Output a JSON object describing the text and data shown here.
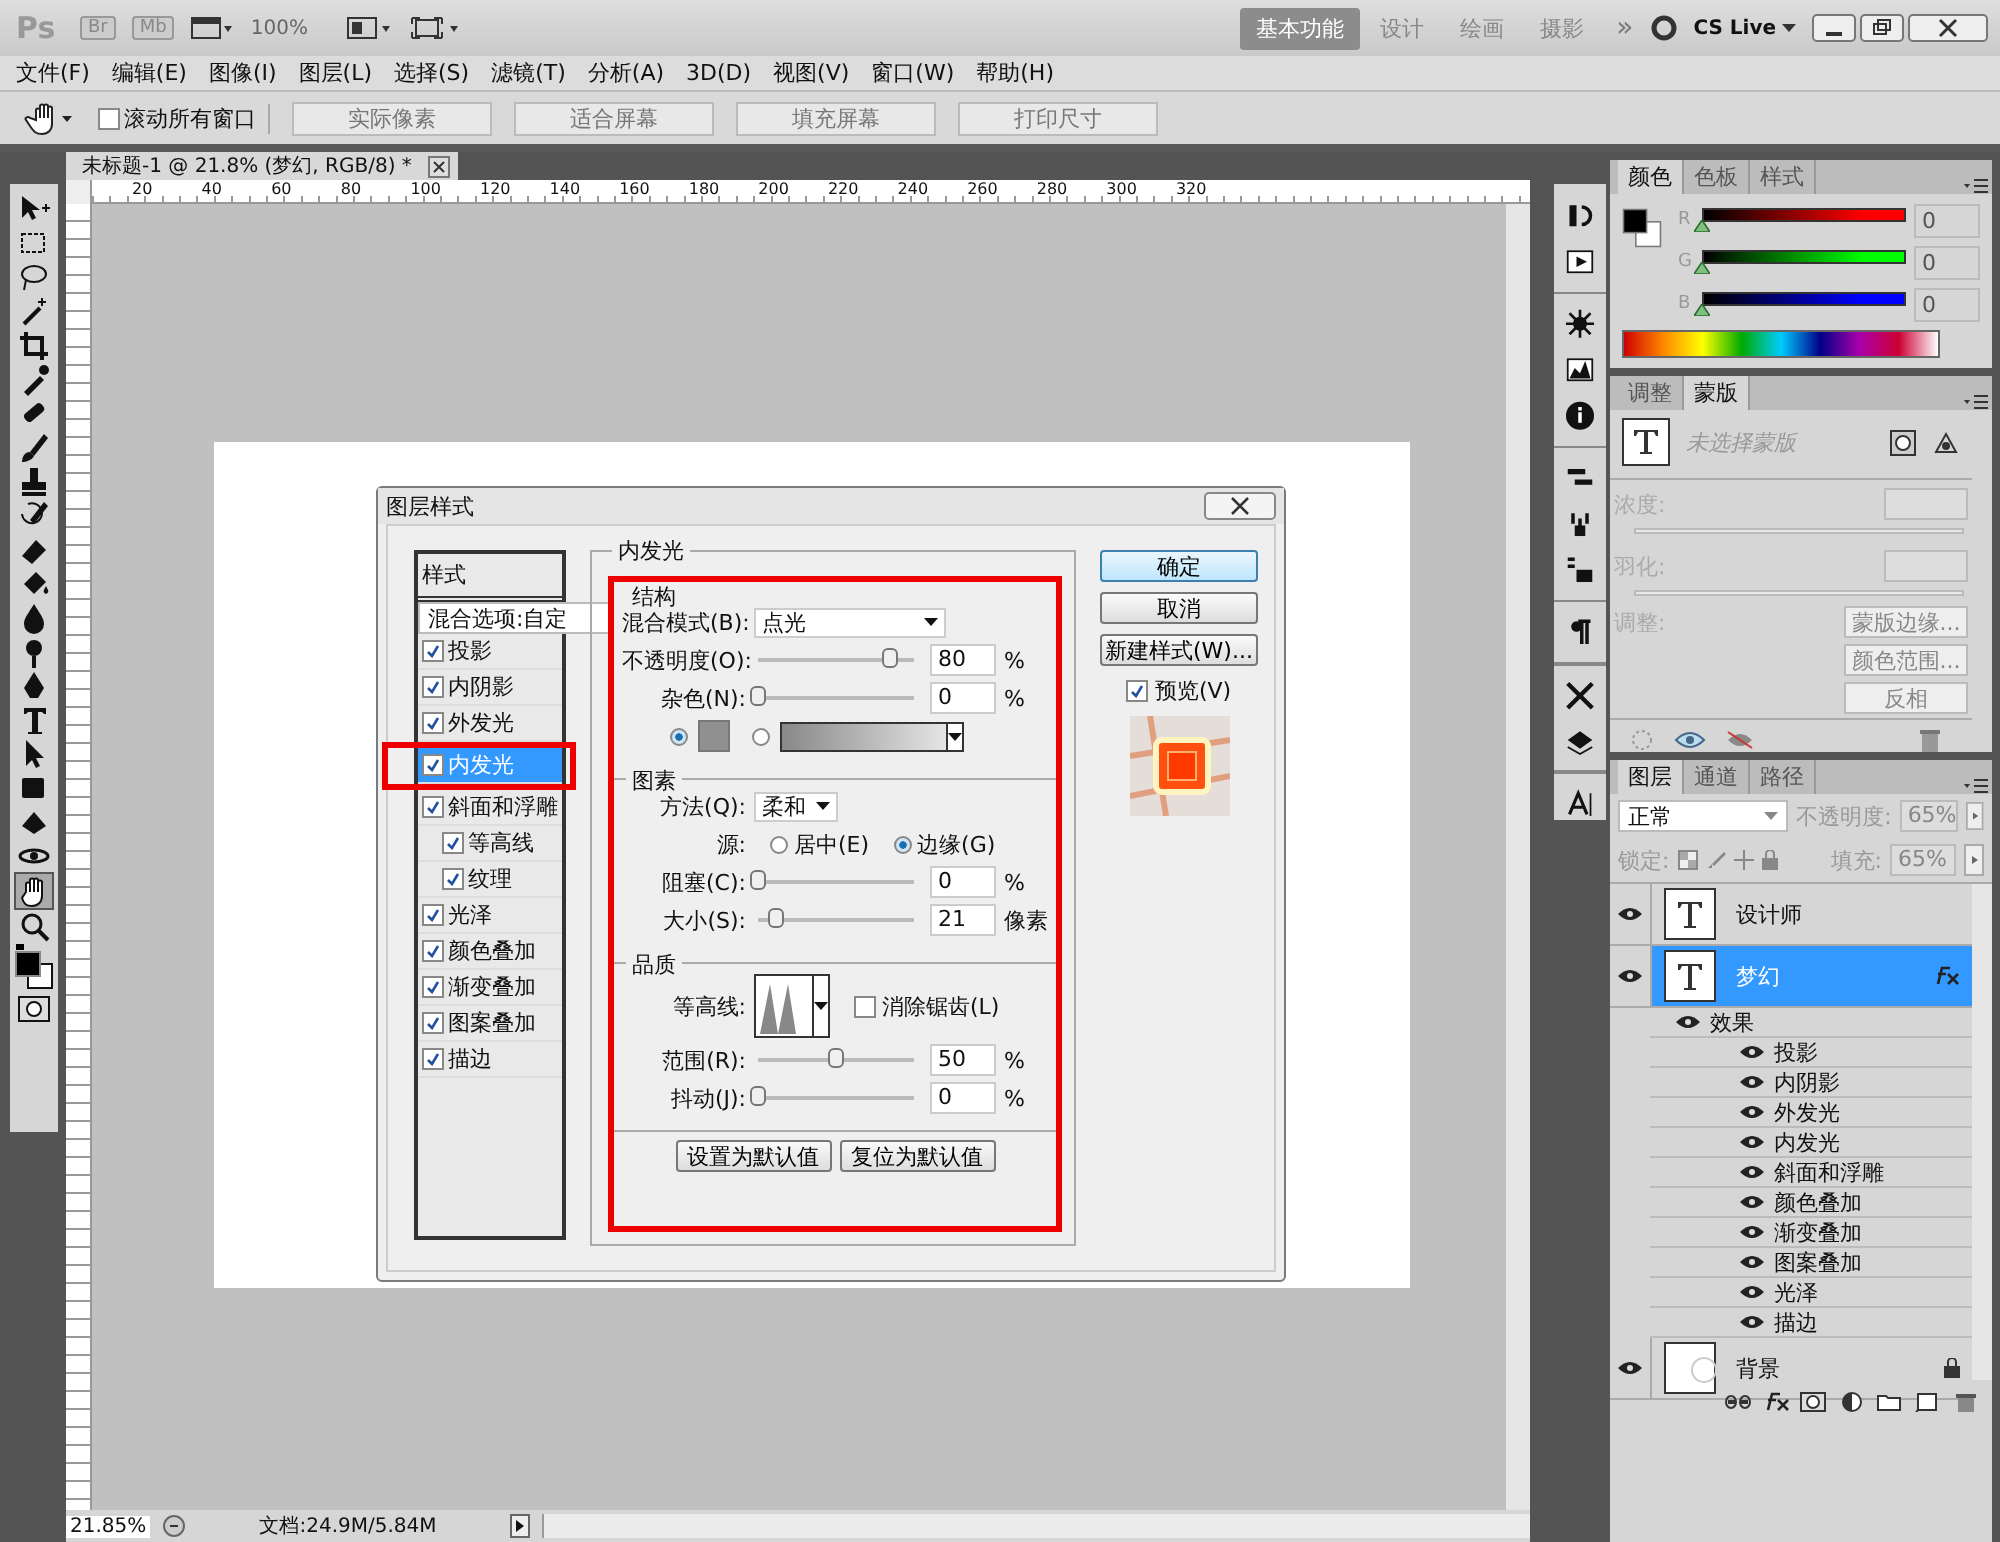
{
  "app_bar": {
    "logo": "Ps",
    "bridge": "Br",
    "mini_bridge": "Mb",
    "zoom": "100%",
    "workspaces": [
      {
        "label": "基本功能",
        "selected": true
      },
      {
        "label": "设计",
        "selected": false
      },
      {
        "label": "绘画",
        "selected": false
      },
      {
        "label": "摄影",
        "selected": false
      }
    ],
    "more": "»",
    "cs_live": "CS Live"
  },
  "menu": [
    "文件(F)",
    "编辑(E)",
    "图像(I)",
    "图层(L)",
    "选择(S)",
    "滤镜(T)",
    "分析(A)",
    "3D(D)",
    "视图(V)",
    "窗口(W)",
    "帮助(H)"
  ],
  "options_bar": {
    "scroll_all": {
      "label": "滚动所有窗口",
      "checked": false
    },
    "buttons": [
      "实际像素",
      "适合屏幕",
      "填充屏幕",
      "打印尺寸"
    ]
  },
  "document": {
    "tab_title": "未标题-1 @ 21.8% (梦幻, RGB/8) *",
    "ruler_marks": [
      "20",
      "40",
      "60",
      "80",
      "100",
      "120",
      "140",
      "160",
      "180",
      "200",
      "220",
      "240",
      "260",
      "280",
      "300",
      "320"
    ]
  },
  "dialog": {
    "title": "图层样式",
    "styles_header": "样式",
    "blend_options": "混合选项:自定",
    "effects": [
      {
        "label": "投影",
        "checked": true,
        "selected": false
      },
      {
        "label": "内阴影",
        "checked": true,
        "selected": false
      },
      {
        "label": "外发光",
        "checked": true,
        "selected": false
      },
      {
        "label": "内发光",
        "checked": true,
        "selected": true
      },
      {
        "label": "斜面和浮雕",
        "checked": true,
        "selected": false,
        "children": [
          {
            "label": "等高线",
            "checked": true,
            "selected": false
          },
          {
            "label": "纹理",
            "checked": true,
            "selected": false
          }
        ]
      },
      {
        "label": "光泽",
        "checked": true,
        "selected": false
      },
      {
        "label": "颜色叠加",
        "checked": true,
        "selected": false
      },
      {
        "label": "渐变叠加",
        "checked": true,
        "selected": false
      },
      {
        "label": "图案叠加",
        "checked": true,
        "selected": false
      },
      {
        "label": "描边",
        "checked": true,
        "selected": false
      }
    ],
    "section_title": "内发光",
    "structure": {
      "title": "结构",
      "blend_mode": {
        "label": "混合模式(B):",
        "value": "点光"
      },
      "sliders": [
        {
          "label": "不透明度(O):",
          "level": 0.85,
          "value": "80",
          "unit": "%"
        },
        {
          "label": "杂色(N):",
          "level": 0,
          "value": "0",
          "unit": "%"
        }
      ],
      "fill": [
        {
          "kind": "solid",
          "selected": true
        },
        {
          "kind": "gradient",
          "selected": false
        }
      ]
    },
    "elements": {
      "title": "图素",
      "technique": {
        "label": "方法(Q):",
        "value": "柔和"
      },
      "source": {
        "label": "源:",
        "options": [
          {
            "label": "居中(E)",
            "selected": false
          },
          {
            "label": "边缘(G)",
            "selected": true
          }
        ]
      },
      "sliders": [
        {
          "label": "阻塞(C):",
          "level": 0,
          "value": "0",
          "unit": "%"
        },
        {
          "label": "大小(S):",
          "level": 0.12,
          "value": "21",
          "unit": "像素"
        }
      ]
    },
    "quality": {
      "title": "品质",
      "contour_label": "等高线:",
      "anti_alias": {
        "label": "消除锯齿(L)",
        "checked": false
      },
      "sliders": [
        {
          "label": "范围(R):",
          "level": 0.5,
          "value": "50",
          "unit": "%"
        },
        {
          "label": "抖动(J):",
          "level": 0,
          "value": "0",
          "unit": "%"
        }
      ]
    },
    "footer_buttons": [
      "设置为默认值",
      "复位为默认值"
    ],
    "side_buttons": [
      {
        "label": "确定",
        "kind": "default"
      },
      {
        "label": "取消",
        "kind": "normal"
      },
      {
        "label": "新建样式(W)...",
        "kind": "normal"
      }
    ],
    "preview": {
      "label": "预览(V)",
      "checked": true
    }
  },
  "color_panel": {
    "tabs": [
      {
        "label": "颜色",
        "selected": true
      },
      {
        "label": "色板",
        "selected": false
      },
      {
        "label": "样式",
        "selected": false
      }
    ],
    "channels": [
      {
        "label": "R",
        "value": "0",
        "level": 0,
        "color": "#ff0000"
      },
      {
        "label": "G",
        "value": "0",
        "level": 0,
        "color": "#00ff00"
      },
      {
        "label": "B",
        "value": "0",
        "level": 0,
        "color": "#0000ff"
      }
    ]
  },
  "mask_panel": {
    "tabs": [
      {
        "label": "调整",
        "selected": false
      },
      {
        "label": "蒙版",
        "selected": true
      }
    ],
    "hint": "未选择蒙版",
    "density": "浓度:",
    "feather": "羽化:",
    "refine": "调整:",
    "buttons": [
      "蒙版边缘...",
      "颜色范围...",
      "反相"
    ]
  },
  "layers_panel": {
    "tabs": [
      {
        "label": "图层",
        "selected": true
      },
      {
        "label": "通道",
        "selected": false
      },
      {
        "label": "路径",
        "selected": false
      }
    ],
    "blend_mode": "正常",
    "opacity_label": "不透明度:",
    "opacity": "65%",
    "lock_label": "锁定:",
    "fill_label": "填充:",
    "fill": "65%",
    "layers": [
      {
        "name": "设计师",
        "kind": "text",
        "selected": false,
        "visible": true,
        "fx": false,
        "locked": false
      },
      {
        "name": "梦幻",
        "kind": "text",
        "selected": true,
        "visible": true,
        "fx": true,
        "locked": false,
        "children": [
          {
            "name": "效果",
            "children": [
              {
                "name": "投影"
              },
              {
                "name": "内阴影"
              },
              {
                "name": "外发光"
              },
              {
                "name": "内发光"
              },
              {
                "name": "斜面和浮雕"
              },
              {
                "name": "颜色叠加"
              },
              {
                "name": "渐变叠加"
              },
              {
                "name": "图案叠加"
              },
              {
                "name": "光泽"
              },
              {
                "name": "描边"
              }
            ]
          }
        ]
      },
      {
        "name": "背景",
        "kind": "image",
        "selected": false,
        "visible": true,
        "fx": false,
        "locked": true
      }
    ]
  },
  "status_bar": {
    "zoom": "21.85%",
    "doc_size": "文档:24.9M/5.84M"
  }
}
